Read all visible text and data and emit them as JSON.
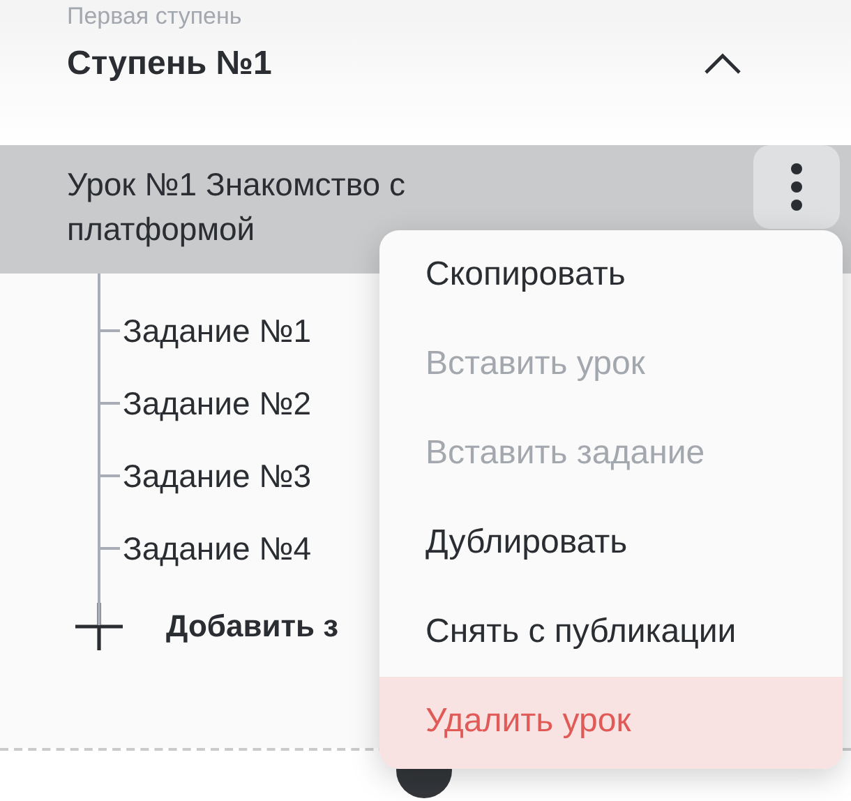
{
  "stage": {
    "subtitle": "Первая ступень",
    "title": "Ступень №1",
    "expanded": true
  },
  "lesson": {
    "title": "Урок №1 Знакомство с платформой",
    "selected": true
  },
  "tasks": [
    {
      "label": "Задание №1"
    },
    {
      "label": "Задание №2"
    },
    {
      "label": "Задание №3"
    },
    {
      "label": "Задание №4"
    }
  ],
  "add_task": {
    "label": "Добавить з"
  },
  "context_menu": [
    {
      "label": "Скопировать",
      "kind": "normal",
      "disabled": false
    },
    {
      "label": "Вставить урок",
      "kind": "normal",
      "disabled": true
    },
    {
      "label": "Вставить задание",
      "kind": "normal",
      "disabled": true
    },
    {
      "label": "Дублировать",
      "kind": "normal",
      "disabled": false
    },
    {
      "label": "Снять с публикации",
      "kind": "normal",
      "disabled": false
    },
    {
      "label": "Удалить урок",
      "kind": "danger",
      "disabled": false
    }
  ]
}
